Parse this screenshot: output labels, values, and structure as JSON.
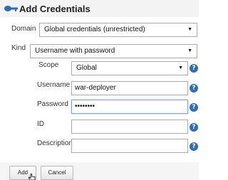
{
  "header": {
    "title": "Add Credentials",
    "icon": "credentials-key-icon"
  },
  "domain": {
    "label": "Domain",
    "value": "Global credentials (unrestricted)"
  },
  "kind": {
    "label": "Kind",
    "value": "Username with password"
  },
  "scope": {
    "label": "Scope",
    "value": "Global"
  },
  "username": {
    "label": "Username",
    "value": "war-deployer"
  },
  "password": {
    "label": "Password",
    "value": "••••••••"
  },
  "id": {
    "label": "ID",
    "value": ""
  },
  "description": {
    "label": "Description",
    "value": ""
  },
  "help_icon": "?",
  "buttons": {
    "add": "Add",
    "cancel": "Cancel"
  },
  "colors": {
    "help": "#2f6db5",
    "focus": "#7aa7d6"
  }
}
